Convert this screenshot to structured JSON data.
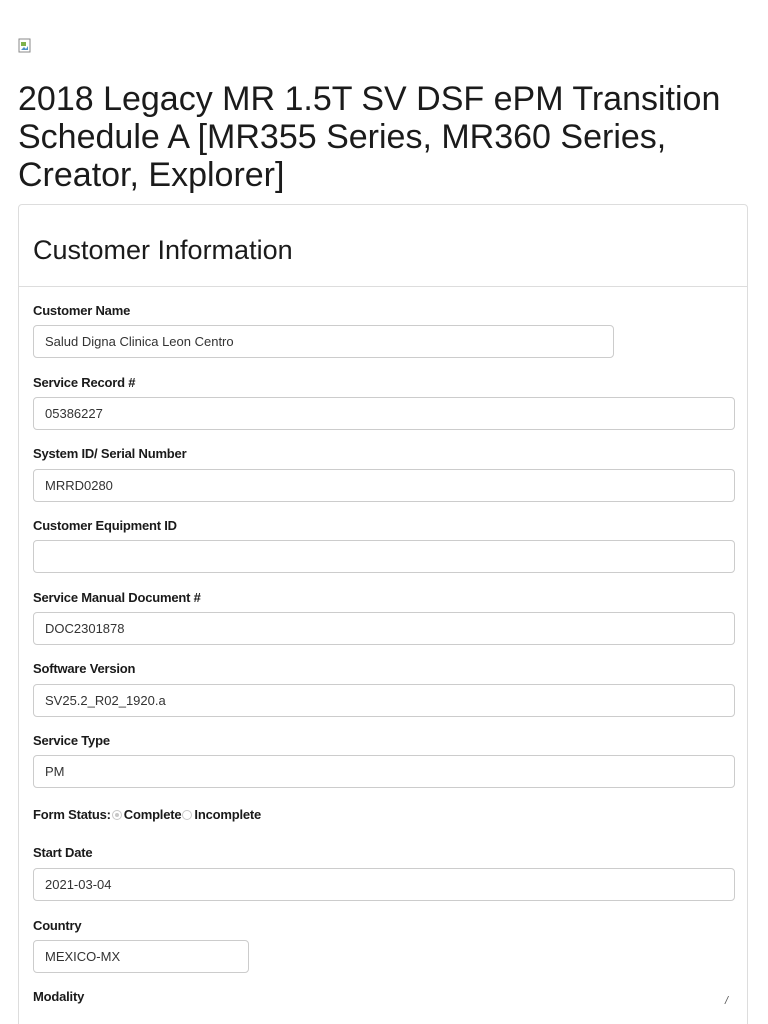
{
  "page_title": "2018 Legacy MR 1.5T SV DSF ePM Transition Schedule A [MR355 Series, MR360 Series, Creator, Explorer]",
  "icons": {
    "broken_image": "broken-image-icon"
  },
  "panel": {
    "title": "Customer Information"
  },
  "fields": {
    "customer_name": {
      "label": "Customer Name",
      "value": "Salud Digna Clinica Leon Centro"
    },
    "service_record": {
      "label": "Service Record #",
      "value": "05386227"
    },
    "system_id": {
      "label": "System ID/ Serial Number",
      "value": "MRRD0280"
    },
    "customer_equipment_id": {
      "label": "Customer Equipment ID",
      "value": ""
    },
    "service_manual_doc": {
      "label": "Service Manual Document #",
      "value": "DOC2301878"
    },
    "software_version": {
      "label": "Software Version",
      "value": "SV25.2_R02_1920.a"
    },
    "service_type": {
      "label": "Service Type",
      "value": "PM"
    },
    "start_date": {
      "label": "Start Date",
      "value": "2021-03-04"
    },
    "country": {
      "label": "Country",
      "value": "MEXICO-MX"
    },
    "modality": {
      "label": "Modality"
    }
  },
  "form_status": {
    "label": "Form Status:",
    "options": [
      {
        "label": "Complete",
        "selected": true
      },
      {
        "label": "Incomplete",
        "selected": false
      }
    ]
  },
  "resize_mark": "/"
}
